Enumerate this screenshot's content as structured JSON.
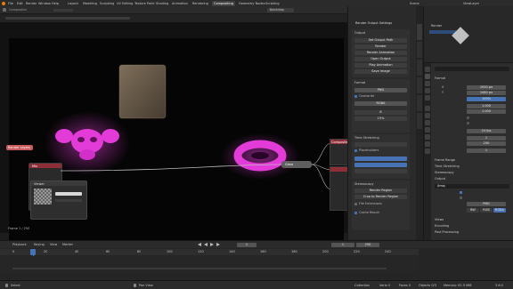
{
  "menubar": {
    "app": "Blender",
    "items": [
      "File",
      "Edit",
      "Render",
      "Window",
      "Help"
    ],
    "workspaces": [
      "Layout",
      "Modeling",
      "Sculpting",
      "UV Editing",
      "Texture Paint",
      "Shading",
      "Animation",
      "Rendering",
      "Compositing",
      "Geometry Nodes",
      "Scripting"
    ],
    "scene": "Scene",
    "view_layer": "ViewLayer"
  },
  "compositor": {
    "header_text": "Compositor",
    "backdrop_label": "Backdrop",
    "nodes": {
      "render_layers": "Render Layers",
      "composite": "Composite",
      "viewer": "Viewer",
      "glare": "Glare",
      "mix": "Mix"
    },
    "status": "Frame 1 / 250"
  },
  "npanel": {
    "title": "Render Output Settings",
    "sections": [
      "Output",
      "Format",
      "Time Stretching",
      "Stereoscopy",
      "Encoding"
    ],
    "buttons": [
      "Set Output Path",
      "Render",
      "Render Animation",
      "Open Output",
      "Play Animation",
      "Save Image"
    ],
    "format_label": "File Format",
    "format_value": "PNG",
    "color": "RGBA",
    "color_depth": "8",
    "compression": "15%",
    "checkbox_overwrite": "Overwrite",
    "checkbox_placeholders": "Placeholders",
    "checkbox_use_ext": "File Extensions",
    "checkbox_cache": "Cache Result",
    "bottom_button_1": "Render Region",
    "bottom_button_2": "Crop to Render Region"
  },
  "properties": {
    "object_name": "Render",
    "tabs": [
      "Render",
      "Output",
      "View Layer",
      "Scene",
      "World",
      "Object",
      "Modifiers",
      "Particles",
      "Physics",
      "Constraints",
      "Data",
      "Material"
    ],
    "sections": [
      "Format",
      "Frame Range",
      "Time Stretching",
      "Stereoscopy",
      "Output",
      "Views",
      "Encoding",
      "Post Processing",
      "Metadata"
    ],
    "resolution_x": "1920 px",
    "resolution_y": "1080 px",
    "resolution_pct": "100%",
    "aspect_x": "1.000",
    "aspect_y": "1.000",
    "frame_rate": "24 fps",
    "frame_start": "1",
    "frame_end": "250",
    "step": "1",
    "output_path": "/tmp/",
    "file_format": "PNG",
    "color_mode_opts": [
      "BW",
      "RGB",
      "RGBA"
    ],
    "color_mode_active": "RGBA"
  },
  "timeline": {
    "menus": [
      "Playback",
      "Keying",
      "View",
      "Marker"
    ],
    "current_frame": "1",
    "start": "1",
    "end": "250",
    "ticks": [
      "0",
      "20",
      "40",
      "60",
      "80",
      "100",
      "120",
      "140",
      "160",
      "180",
      "200",
      "220",
      "240"
    ]
  },
  "statusbar": {
    "left": "Select",
    "middle": "Pan View",
    "right_items": [
      "Collection",
      "Verts 0",
      "Faces 0",
      "Objects 0/3",
      "Memory: 61.5 MiB",
      "3.6.0"
    ]
  },
  "colors": {
    "magenta": "#e23bd8",
    "panel_bg": "#303030",
    "viewport_bg": "#0a0a0a",
    "accent": "#4772b3",
    "node_header_red": "#8f2e36"
  }
}
